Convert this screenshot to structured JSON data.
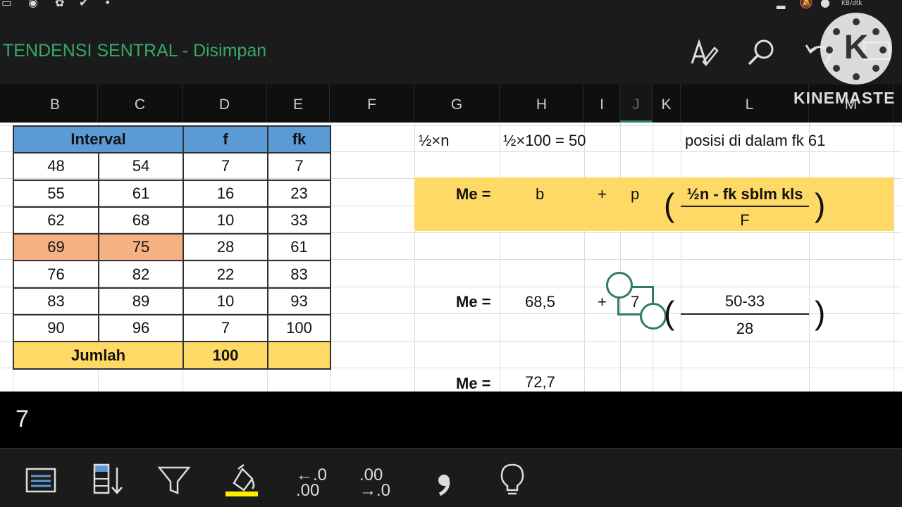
{
  "status_bar": {
    "speed": "KB/dtk"
  },
  "title_bar": {
    "title": "TENDENSI SENTRAL - Disimpan",
    "watermark_letter": "K"
  },
  "columns": [
    "B",
    "C",
    "D",
    "E",
    "F",
    "G",
    "H",
    "I",
    "J",
    "K",
    "L",
    "M"
  ],
  "kinemaster_label": "KINEMASTE",
  "freq_table": {
    "headers": {
      "interval": "Interval",
      "f": "f",
      "fk": "fk"
    },
    "rows": [
      {
        "lo": "48",
        "hi": "54",
        "f": "7",
        "fk": "7"
      },
      {
        "lo": "55",
        "hi": "61",
        "f": "16",
        "fk": "23"
      },
      {
        "lo": "62",
        "hi": "68",
        "f": "10",
        "fk": "33"
      },
      {
        "lo": "69",
        "hi": "75",
        "f": "28",
        "fk": "61"
      },
      {
        "lo": "76",
        "hi": "82",
        "f": "22",
        "fk": "83"
      },
      {
        "lo": "83",
        "hi": "89",
        "f": "10",
        "fk": "93"
      },
      {
        "lo": "90",
        "hi": "96",
        "f": "7",
        "fk": "100"
      }
    ],
    "total": {
      "label": "Jumlah",
      "f": "100",
      "fk": ""
    }
  },
  "calc": {
    "half_n": "½×n",
    "half_n_value": "½×100 = 50",
    "position_note": "posisi di dalam fk 61"
  },
  "formula": {
    "me": "Me =",
    "b": "b",
    "plus": "+",
    "p": "p",
    "numerator": "½n - fk sblm kls",
    "denominator": "F",
    "paren_open": "(",
    "paren_close": ")"
  },
  "substitution": {
    "me": "Me =",
    "b": "68,5",
    "plus": "+",
    "p": "7",
    "numerator": "50-33",
    "denominator": "28",
    "paren_open": "(",
    "paren_close": ")"
  },
  "result": {
    "me": "Me =",
    "value": "72,7"
  },
  "formula_bar": {
    "value": "7"
  },
  "colors": {
    "title_green": "#39a86a",
    "header_blue": "#5b9bd5",
    "highlight_orange": "#f4b183",
    "band_yellow": "#ffd966",
    "selection_green": "#2e7d5b"
  }
}
